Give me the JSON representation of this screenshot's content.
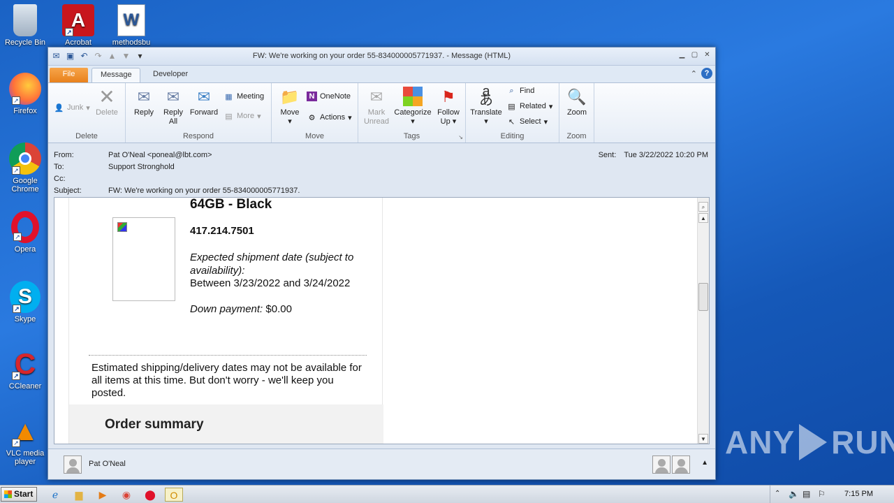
{
  "desktop": {
    "icons": [
      {
        "label": "Recycle Bin",
        "glyph": "🗑"
      },
      {
        "label": "Acrobat",
        "glyph": "A"
      },
      {
        "label": "methodsbu",
        "glyph": "W"
      },
      {
        "label": "Firefox",
        "glyph": "🦊"
      },
      {
        "label": "Google Chrome",
        "glyph": "◉"
      },
      {
        "label": "Opera",
        "glyph": "O"
      },
      {
        "label": "Skype",
        "glyph": "S"
      },
      {
        "label": "CCleaner",
        "glyph": "C"
      },
      {
        "label": "VLC media player",
        "glyph": "▲"
      }
    ]
  },
  "window": {
    "title": "FW: We're working on your order 55-834000005771937. - Message (HTML)",
    "tabs": {
      "file": "File",
      "message": "Message",
      "developer": "Developer"
    }
  },
  "ribbon": {
    "delete_group": {
      "label": "Delete",
      "junk": "Junk",
      "delete": "Delete"
    },
    "respond_group": {
      "label": "Respond",
      "reply": "Reply",
      "reply_all_1": "Reply",
      "reply_all_2": "All",
      "forward": "Forward",
      "meeting": "Meeting",
      "more": "More"
    },
    "move_group": {
      "label": "Move",
      "move": "Move",
      "onenote": "OneNote",
      "actions": "Actions"
    },
    "tags_group": {
      "label": "Tags",
      "mark_unread_1": "Mark",
      "mark_unread_2": "Unread",
      "categorize": "Categorize",
      "follow_up_1": "Follow",
      "follow_up_2": "Up"
    },
    "editing_group": {
      "label": "Editing",
      "translate": "Translate",
      "find": "Find",
      "related": "Related",
      "select": "Select"
    },
    "zoom_group": {
      "label": "Zoom",
      "zoom": "Zoom"
    }
  },
  "headers": {
    "from_label": "From:",
    "from_value": "Pat O'Neal <poneal@lbt.com>",
    "to_label": "To:",
    "to_value": "Support Stronghold",
    "cc_label": "Cc:",
    "cc_value": "",
    "subject_label": "Subject:",
    "subject_value": "FW: We're working on your order 55-834000005771937.",
    "sent_label": "Sent:",
    "sent_value": "Tue 3/22/2022 10:20 PM"
  },
  "email": {
    "product_title": "64GB - Black",
    "phone": "417.214.7501",
    "ship_label": "Expected shipment date (subject to availability):",
    "ship_dates": "Between 3/23/2022 and 3/24/2022",
    "down_label": "Down payment:",
    "down_value": "$0.00",
    "estimate_note": "Estimated shipping/delivery dates may not be available for all items at this time. But don't worry - we'll keep you posted.",
    "summary_heading": "Order summary"
  },
  "people_pane": {
    "name": "Pat O'Neal"
  },
  "watermark": {
    "left": "ANY",
    "right": "RUN"
  },
  "taskbar": {
    "start": "Start",
    "clock": "7:15 PM"
  }
}
